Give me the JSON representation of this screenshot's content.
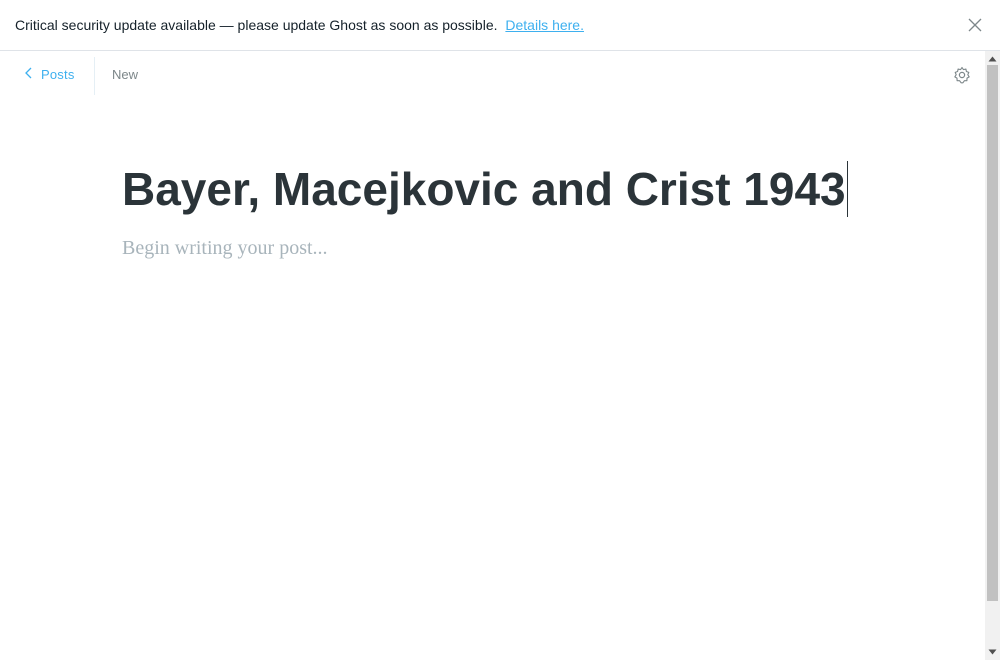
{
  "banner": {
    "message": "Critical security update available — please update Ghost as soon as possible.",
    "link_text": "Details here.",
    "close_icon": "close-icon"
  },
  "topbar": {
    "back_label": "Posts",
    "status": "New",
    "settings_icon": "gear-icon"
  },
  "editor": {
    "title": "Bayer, Macejkovic and Crist 1943",
    "body_placeholder": "Begin writing your post..."
  },
  "colors": {
    "accent": "#3eb0ef",
    "title": "#2b3439",
    "placeholder": "#a8b4bb"
  }
}
